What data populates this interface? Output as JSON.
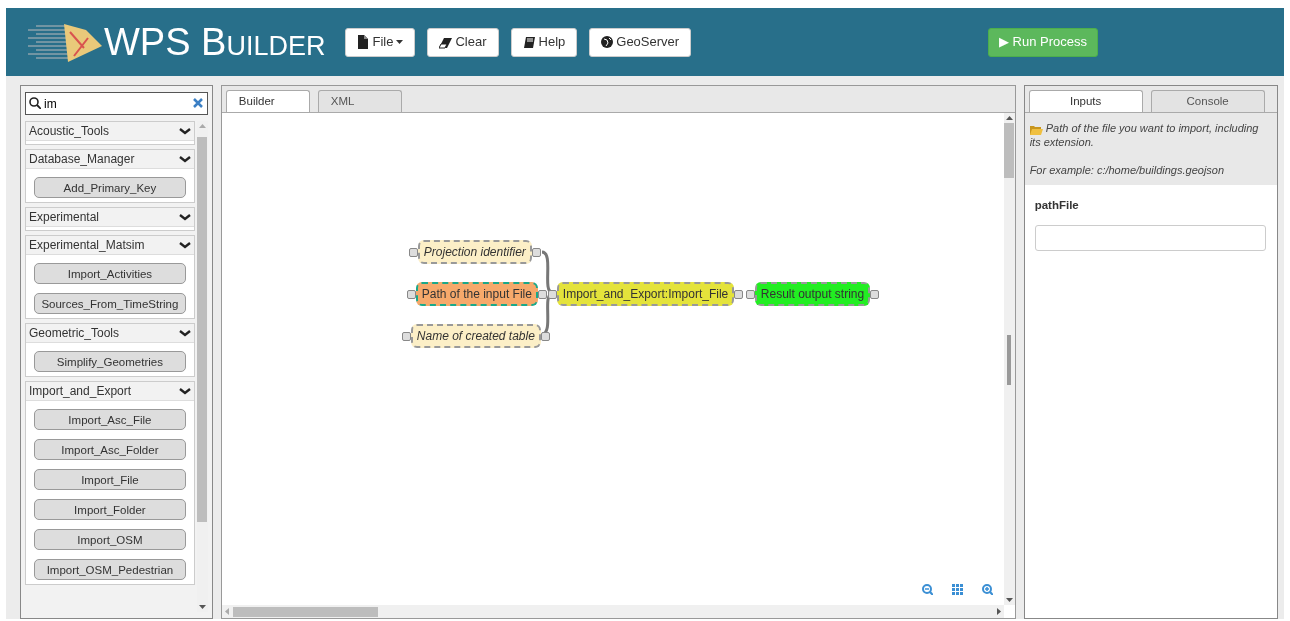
{
  "header": {
    "title": "WPS Builder",
    "buttons": [
      {
        "label": "File",
        "caret": true
      },
      {
        "label": "Clear",
        "caret": false
      },
      {
        "label": "Help",
        "caret": false
      },
      {
        "label": "GeoServer",
        "caret": false
      }
    ],
    "run_button": "▶ Run Process"
  },
  "sidebar": {
    "search": {
      "value": "im"
    },
    "groups": [
      {
        "name": "Acoustic_Tools"
      },
      {
        "name": "Database_Manager",
        "items": [
          "Add_Primary_Key"
        ]
      },
      {
        "name": "Experimental"
      },
      {
        "name": "Experimental_Matsim",
        "items": [
          "Import_Activities",
          "Sources_From_TimeString"
        ]
      },
      {
        "name": "Geometric_Tools",
        "items": [
          "Simplify_Geometries"
        ]
      },
      {
        "name": "Import_and_Export",
        "items": [
          "Import_Asc_File",
          "Import_Asc_Folder",
          "Import_File",
          "Import_Folder",
          "Import_OSM",
          "Import_OSM_Pedestrian"
        ]
      }
    ]
  },
  "center_tabs": [
    {
      "label": "Builder",
      "selected": true
    },
    {
      "label": "XML",
      "selected": false
    }
  ],
  "nodes": [
    {
      "label": "Projection identifier",
      "kind": "input",
      "optional": true,
      "selected": false
    },
    {
      "label": "Path of the input File",
      "kind": "input",
      "optional": false,
      "selected": true
    },
    {
      "label": "Name of created table",
      "kind": "input",
      "optional": true,
      "selected": false
    },
    {
      "label": "Import_and_Export:Import_File",
      "kind": "process",
      "optional": false,
      "selected": false
    },
    {
      "label": "Result output string",
      "kind": "output",
      "optional": false,
      "selected": false
    }
  ],
  "right_tabs": [
    {
      "label": "Inputs",
      "selected": true
    },
    {
      "label": "Console",
      "selected": false
    }
  ],
  "help": {
    "description": "Path of the file you want to import, including its extension.",
    "example": "For example: c:/home/buildings.geojson"
  },
  "field": {
    "label": "pathFile"
  }
}
